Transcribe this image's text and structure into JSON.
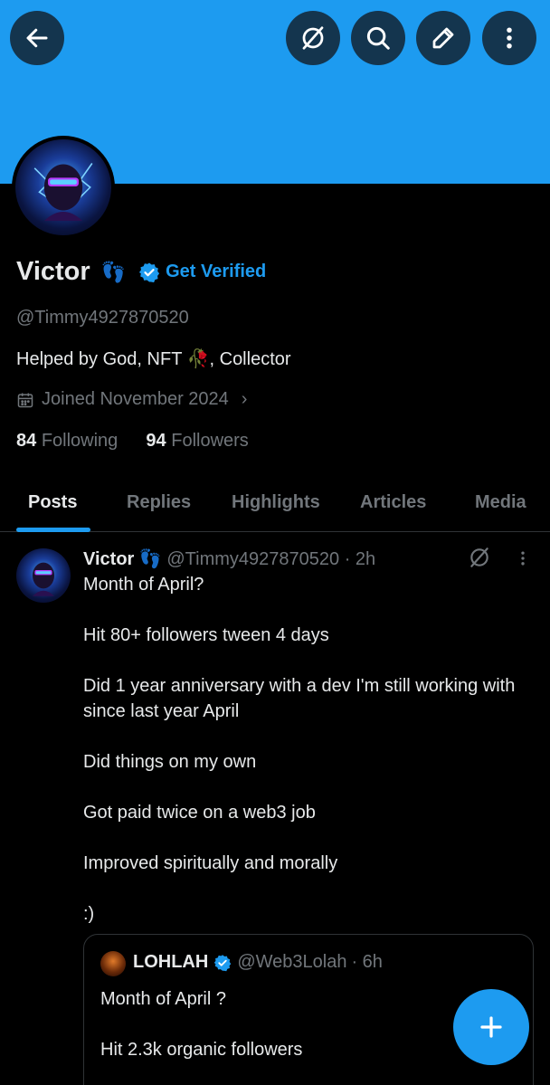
{
  "header": {
    "icons": [
      "back-arrow-icon",
      "grok-icon",
      "search-icon",
      "edit-icon",
      "more-vertical-icon"
    ],
    "banner_color": "#1d9bf0",
    "button_bg": "#14354e"
  },
  "profile": {
    "name": "Victor",
    "name_emoji": "👣",
    "get_verified": "Get Verified",
    "handle": "@Timmy4927870520",
    "bio": "Helped by God, NFT 🥀, Collector",
    "joined": "Joined November 2024",
    "following_count": "84",
    "following_label": "Following",
    "followers_count": "94",
    "followers_label": "Followers"
  },
  "tabs": [
    {
      "label": "Posts",
      "active": true
    },
    {
      "label": "Replies",
      "active": false
    },
    {
      "label": "Highlights",
      "active": false
    },
    {
      "label": "Articles",
      "active": false
    },
    {
      "label": "Media",
      "active": false
    }
  ],
  "post": {
    "name": "Victor",
    "name_emoji": "👣",
    "handle": "@Timmy4927870520",
    "time": "· 2h",
    "lines": [
      "Month of April?",
      "Hit 80+ followers tween 4 days",
      "Did 1 year anniversary with a dev I'm still working with since last year April",
      "Did things on my own",
      "Got paid twice on a web3 job",
      "Improved spiritually and morally",
      ":)"
    ],
    "quote": {
      "name": "LOHLAH",
      "handle": "@Web3Lolah",
      "time": "· 6h",
      "lines": [
        "Month of April ?",
        "Hit 2.3k organic followers"
      ]
    }
  },
  "colors": {
    "accent": "#1d9bf0",
    "text": "#e7e9ea",
    "muted": "#71767b",
    "border": "#2f3336",
    "background": "#000000"
  }
}
